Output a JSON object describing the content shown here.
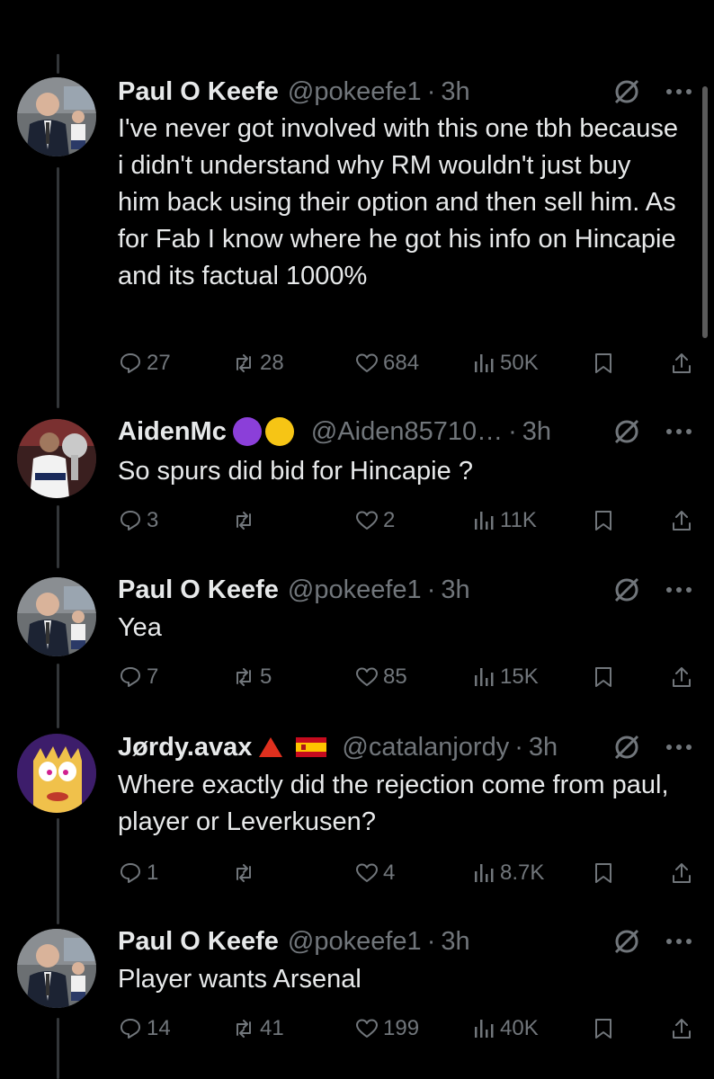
{
  "tweets": [
    {
      "name": "Paul O Keefe",
      "handle": "@pokeefe1",
      "time": "3h",
      "text": "I've never got involved with this one tbh because i didn't understand why RM wouldn't just buy him back using their option and then sell him. As for Fab I know where he got his info on Hincapie and its factual 1000%",
      "replies": "27",
      "reposts": "28",
      "likes": "684",
      "views": "50K",
      "avatar": "suited-man-photo"
    },
    {
      "name": "AidenMc",
      "handle": "@Aiden85710…",
      "time": "3h",
      "text": "So spurs did bid for Hincapie ?",
      "replies": "3",
      "reposts": "",
      "likes": "2",
      "views": "11K",
      "badges": [
        "purple-circle",
        "yellow-circle"
      ],
      "avatar": "footballer-with-trophy-photo"
    },
    {
      "name": "Paul O Keefe",
      "handle": "@pokeefe1",
      "time": "3h",
      "text": "Yea",
      "replies": "7",
      "reposts": "5",
      "likes": "85",
      "views": "15K",
      "avatar": "suited-man-photo"
    },
    {
      "name": "Jørdy.avax",
      "handle": "@catalanjordy",
      "time": "3h",
      "text": "Where exactly did the rejection come from paul, player or Leverkusen?",
      "replies": "1",
      "reposts": "",
      "likes": "4",
      "views": "8.7K",
      "badges": [
        "red-triangle",
        "spain-flag"
      ],
      "avatar": "cartoon-character"
    },
    {
      "name": "Paul O Keefe",
      "handle": "@pokeefe1",
      "time": "3h",
      "text": "Player wants Arsenal",
      "replies": "14",
      "reposts": "41",
      "likes": "199",
      "views": "40K",
      "avatar": "suited-man-photo"
    }
  ],
  "colors": {
    "background": "#000000",
    "text": "#e7e9ea",
    "muted": "#71767b",
    "thread_line": "#333639"
  }
}
